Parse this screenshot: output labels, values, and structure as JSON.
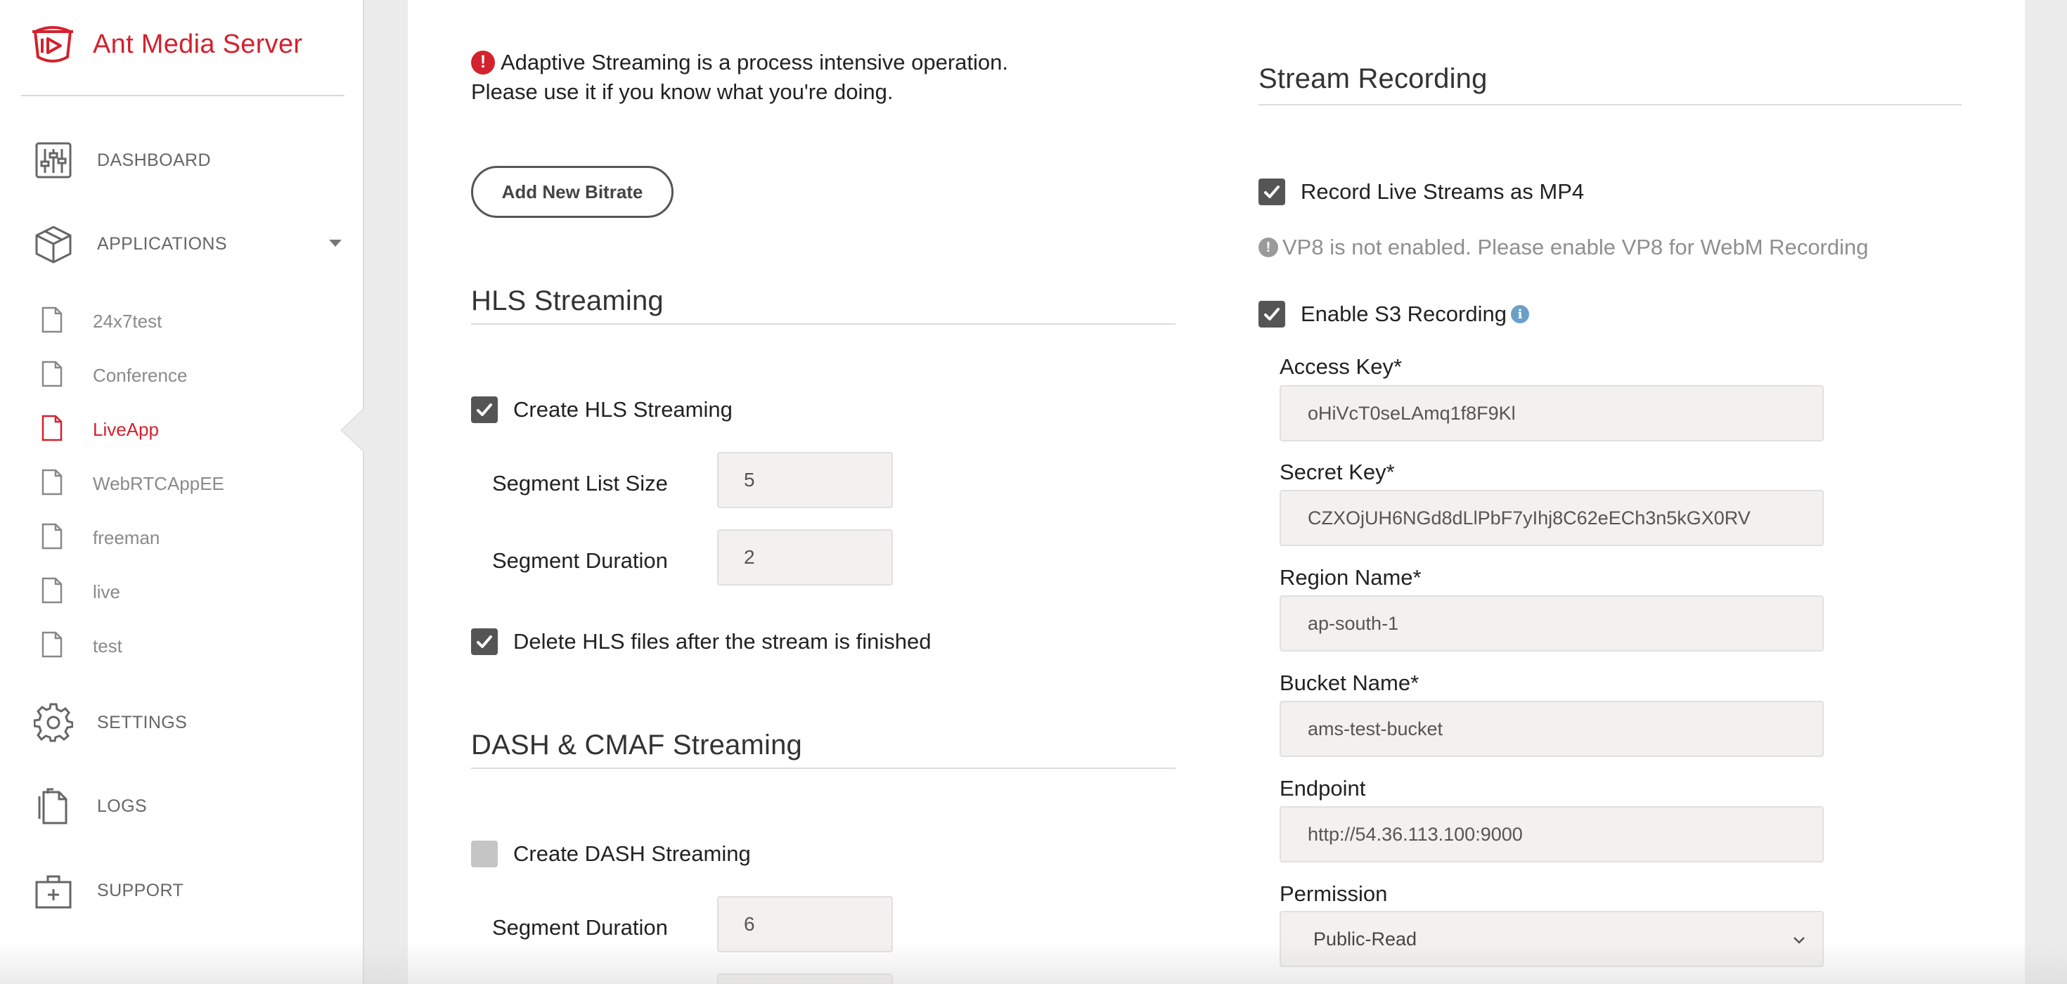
{
  "brand": {
    "name": "Ant Media Server",
    "color": "#d3212e"
  },
  "sidebar": {
    "nav": [
      {
        "label": "DASHBOARD",
        "icon": "sliders-icon"
      },
      {
        "label": "APPLICATIONS",
        "icon": "box-icon"
      },
      {
        "label": "SETTINGS",
        "icon": "gear-icon"
      },
      {
        "label": "LOGS",
        "icon": "document-icon"
      },
      {
        "label": "SUPPORT",
        "icon": "medkit-icon"
      }
    ],
    "apps": [
      {
        "label": "24x7test"
      },
      {
        "label": "Conference"
      },
      {
        "label": "LiveApp",
        "active": true
      },
      {
        "label": "WebRTCAppEE"
      },
      {
        "label": "freeman"
      },
      {
        "label": "live"
      },
      {
        "label": "test"
      }
    ]
  },
  "adaptive": {
    "warning_line1": "Adaptive Streaming is a process intensive operation.",
    "warning_line2": "Please use it if you know what you're doing.",
    "add_button": "Add New Bitrate"
  },
  "hls": {
    "title": "HLS Streaming",
    "create_label": "Create HLS Streaming",
    "create_checked": true,
    "segment_list_size_label": "Segment List Size",
    "segment_list_size": "5",
    "segment_duration_label": "Segment Duration",
    "segment_duration": "2",
    "delete_label": "Delete HLS files after the stream is finished",
    "delete_checked": true
  },
  "dash": {
    "title": "DASH & CMAF Streaming",
    "create_label": "Create DASH Streaming",
    "create_checked": false,
    "segment_duration_label": "Segment Duration",
    "segment_duration": "6"
  },
  "recording": {
    "title": "Stream Recording",
    "mp4_label": "Record Live Streams as MP4",
    "mp4_checked": true,
    "vp8_note": "VP8 is not enabled. Please enable VP8 for WebM Recording",
    "s3_label": "Enable S3 Recording",
    "s3_checked": true,
    "access_key_label": "Access Key*",
    "access_key": "oHiVcT0seLAmq1f8F9Kl",
    "secret_key_label": "Secret Key*",
    "secret_key": "CZXOjUH6NGd8dLlPbF7yIhj8C62eECh3n5kGX0RV",
    "region_label": "Region Name*",
    "region": "ap-south-1",
    "bucket_label": "Bucket Name*",
    "bucket": "ams-test-bucket",
    "endpoint_label": "Endpoint",
    "endpoint": "http://54.36.113.100:9000",
    "permission_label": "Permission",
    "permission": "Public-Read"
  }
}
